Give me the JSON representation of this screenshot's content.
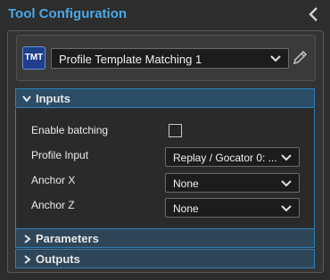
{
  "window": {
    "title": "Tool Configuration",
    "back_icon": "chevron-left-icon"
  },
  "tool": {
    "badge_text": "TMT",
    "badge_color": "#1f3f8a",
    "selected_tool": "Profile Template Matching 1",
    "edit_icon": "pencil-icon"
  },
  "sections": {
    "inputs": {
      "label": "Inputs",
      "expanded": true
    },
    "parameters": {
      "label": "Parameters",
      "expanded": false
    },
    "outputs": {
      "label": "Outputs",
      "expanded": false
    }
  },
  "inputs": {
    "enable_batching": {
      "label": "Enable batching",
      "checked": false
    },
    "profile_input": {
      "label": "Profile Input",
      "value": "Replay / Gocator 0: ..."
    },
    "anchor_x": {
      "label": "Anchor X",
      "value": "None"
    },
    "anchor_z": {
      "label": "Anchor Z",
      "value": "None"
    }
  },
  "colors": {
    "accent": "#4aa8ea",
    "section_border": "#2f7fb8",
    "section_header_bg": "#2b4d66",
    "background": "#2d2d2d"
  }
}
